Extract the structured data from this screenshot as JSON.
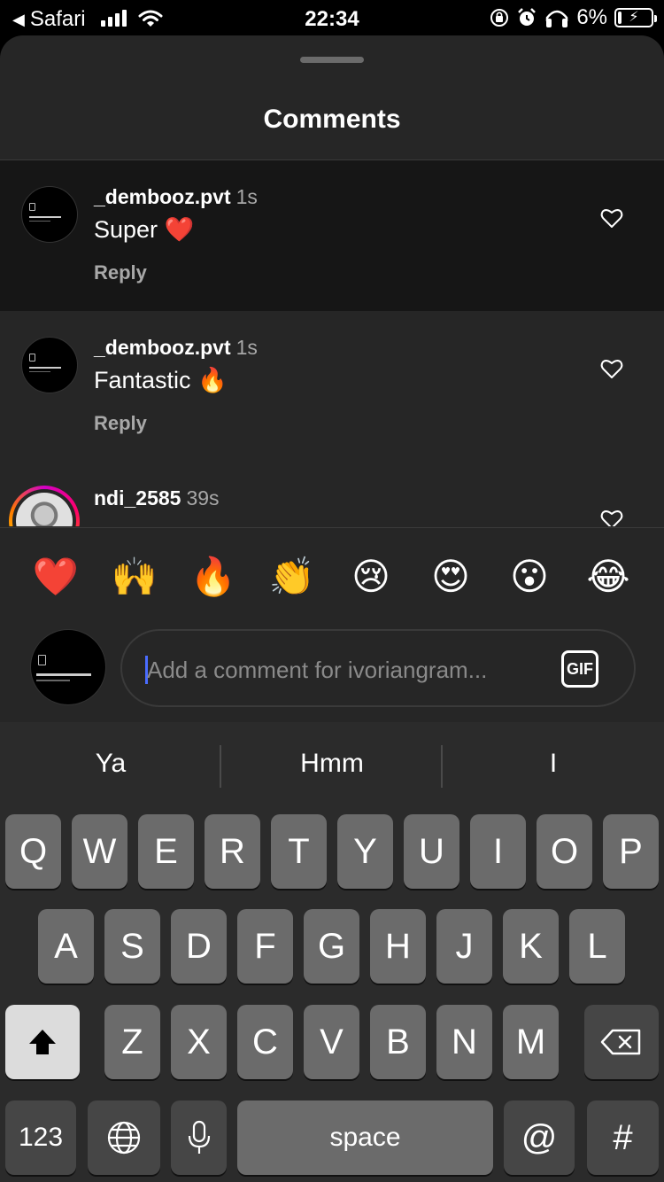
{
  "status_bar": {
    "back_app": "Safari",
    "time": "22:34",
    "battery": "6%"
  },
  "sheet": {
    "title": "Comments"
  },
  "comments": [
    {
      "user": "_dembooz.pvt",
      "time": "1s",
      "text": "Super ❤️",
      "reply": "Reply"
    },
    {
      "user": "_dembooz.pvt",
      "time": "1s",
      "text": "Fantastic 🔥",
      "reply": "Reply"
    },
    {
      "user": "ndi_2585",
      "time": "39s",
      "text": "",
      "reply": ""
    }
  ],
  "emoji_bar": {
    "emojis": [
      "❤️",
      "🙌",
      "🔥",
      "👏",
      "😢",
      "😍",
      "😮",
      "😂"
    ]
  },
  "composer": {
    "placeholder": "Add a comment for ivoriangram...",
    "gif_label": "GIF"
  },
  "keyboard": {
    "suggestions": [
      "Ya",
      "Hmm",
      "I"
    ],
    "row1": [
      "Q",
      "W",
      "E",
      "R",
      "T",
      "Y",
      "U",
      "I",
      "O",
      "P"
    ],
    "row2": [
      "A",
      "S",
      "D",
      "F",
      "G",
      "H",
      "J",
      "K",
      "L"
    ],
    "row3": [
      "Z",
      "X",
      "C",
      "V",
      "B",
      "N",
      "M"
    ],
    "numbers_label": "123",
    "space_label": "space",
    "at_label": "@",
    "hash_label": "#"
  }
}
